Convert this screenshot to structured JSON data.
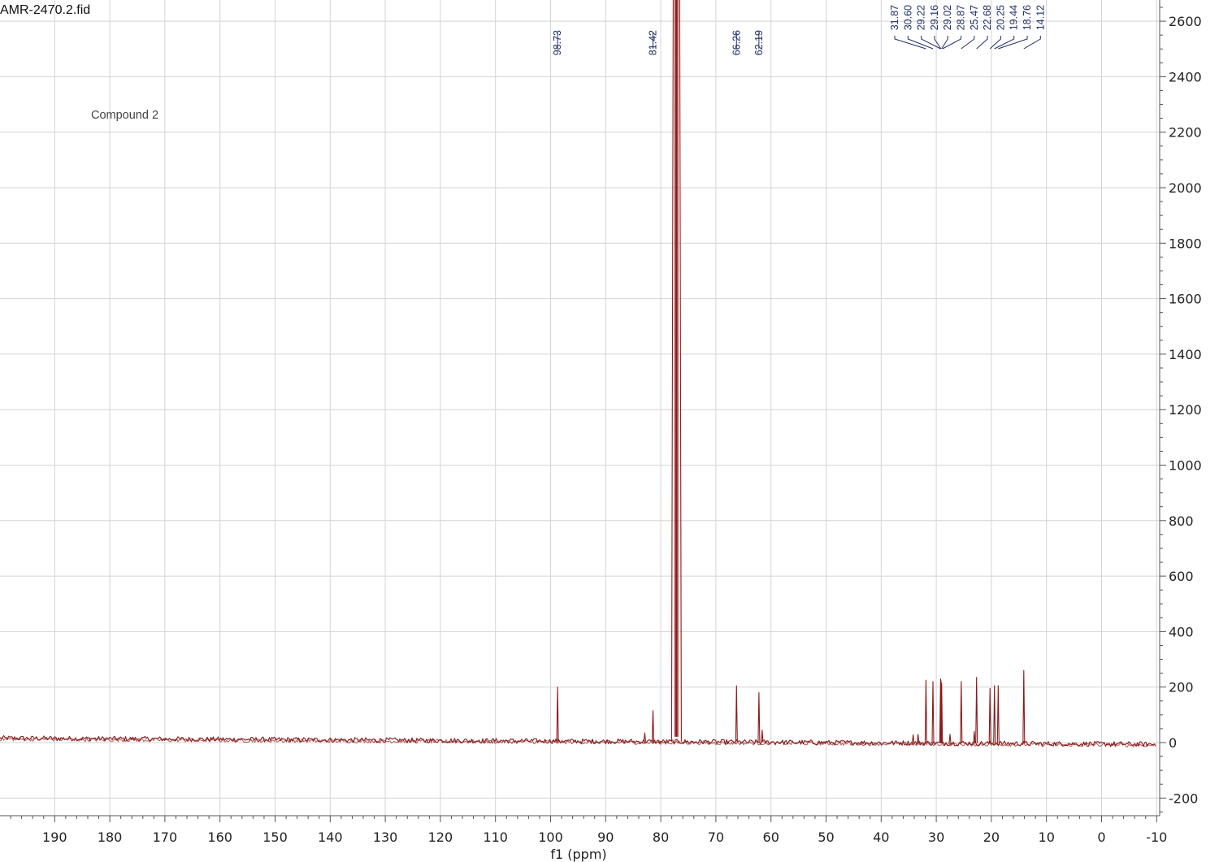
{
  "chart_data": {
    "type": "line",
    "title": "AMR-2470.2.fid",
    "annotation": "Compound 2",
    "xlabel": "f1 (ppm)",
    "ylabel": "",
    "x_reversed": true,
    "xlim": [
      -10,
      200
    ],
    "ylim": [
      -260,
      2660
    ],
    "x_ticks": [
      190,
      180,
      170,
      160,
      150,
      140,
      130,
      120,
      110,
      100,
      90,
      80,
      70,
      60,
      50,
      40,
      30,
      20,
      10,
      0,
      -10
    ],
    "y_ticks": [
      2600,
      2400,
      2200,
      2000,
      1800,
      1600,
      1400,
      1200,
      1000,
      800,
      600,
      400,
      200,
      0,
      -200
    ],
    "grid": true,
    "baseline": {
      "start_ppm": 200,
      "end_ppm": -10,
      "start_intensity": 16,
      "end_intensity": -6
    },
    "solvent_peak": {
      "ppm": 77.16,
      "intensity": 2660,
      "note": "CDCl3 triplet, clipped"
    },
    "series": [
      {
        "name": "",
        "color": "#8b1a1a",
        "peaks": [
          {
            "ppm": 98.73,
            "intensity": 200
          },
          {
            "ppm": 82.9,
            "intensity": 35
          },
          {
            "ppm": 81.42,
            "intensity": 115
          },
          {
            "ppm": 66.26,
            "intensity": 205
          },
          {
            "ppm": 62.19,
            "intensity": 180
          },
          {
            "ppm": 61.6,
            "intensity": 45
          },
          {
            "ppm": 34.2,
            "intensity": 28
          },
          {
            "ppm": 33.3,
            "intensity": 30
          },
          {
            "ppm": 31.87,
            "intensity": 225
          },
          {
            "ppm": 30.6,
            "intensity": 220
          },
          {
            "ppm": 29.22,
            "intensity": 230
          },
          {
            "ppm": 29.16,
            "intensity": 225
          },
          {
            "ppm": 29.02,
            "intensity": 215
          },
          {
            "ppm": 27.5,
            "intensity": 30
          },
          {
            "ppm": 25.47,
            "intensity": 220
          },
          {
            "ppm": 23.1,
            "intensity": 40
          },
          {
            "ppm": 22.68,
            "intensity": 235
          },
          {
            "ppm": 20.25,
            "intensity": 195
          },
          {
            "ppm": 19.44,
            "intensity": 205
          },
          {
            "ppm": 18.76,
            "intensity": 205
          },
          {
            "ppm": 14.12,
            "intensity": 260
          }
        ]
      }
    ],
    "peak_labels": [
      {
        "text": "98.73",
        "ppm": 98.73
      },
      {
        "text": "81.42",
        "ppm": 81.42
      },
      {
        "text": "66.26",
        "ppm": 66.26
      },
      {
        "text": "62.19",
        "ppm": 62.19
      }
    ],
    "peak_label_group": {
      "labels": [
        "31.87",
        "30.60",
        "29.22",
        "29.16",
        "29.02",
        "28.87",
        "25.47",
        "22.68",
        "20.25",
        "19.44",
        "18.76",
        "14.12"
      ],
      "ppms": [
        31.87,
        30.6,
        29.22,
        29.16,
        29.02,
        28.87,
        25.47,
        22.68,
        20.25,
        19.44,
        18.76,
        14.12
      ]
    }
  }
}
